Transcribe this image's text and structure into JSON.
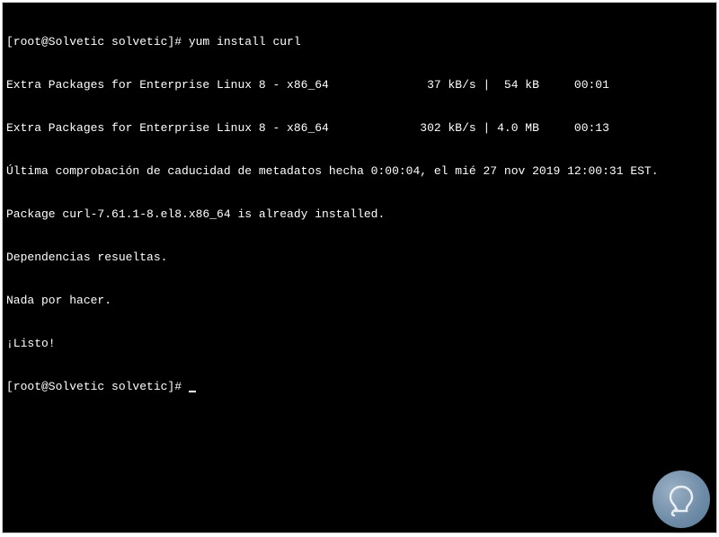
{
  "terminal": {
    "lines": [
      "[root@Solvetic solvetic]# yum install curl",
      "Extra Packages for Enterprise Linux 8 - x86_64              37 kB/s |  54 kB     00:01",
      "Extra Packages for Enterprise Linux 8 - x86_64             302 kB/s | 4.0 MB     00:13",
      "Última comprobación de caducidad de metadatos hecha 0:00:04, el mié 27 nov 2019 12:00:31 EST.",
      "Package curl-7.61.1-8.el8.x86_64 is already installed.",
      "Dependencias resueltas.",
      "Nada por hacer.",
      "¡Listo!",
      "[root@Solvetic solvetic]# "
    ]
  },
  "watermark": {
    "name": "solvetic-logo"
  }
}
